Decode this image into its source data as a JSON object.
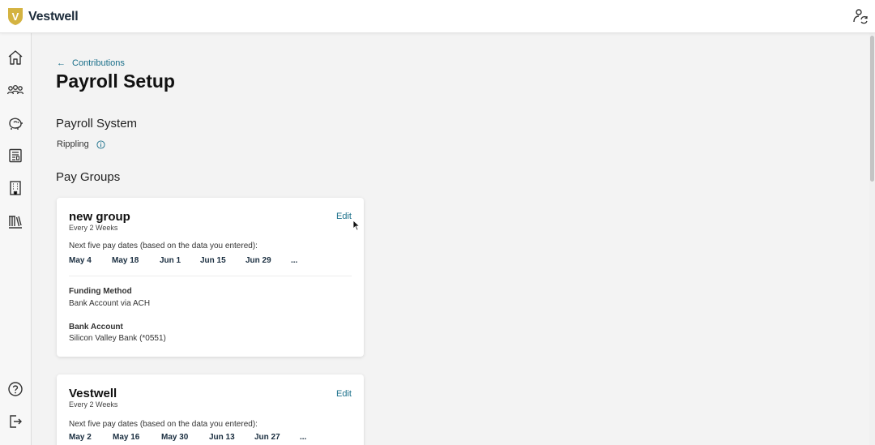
{
  "header": {
    "brand_letter": "V",
    "brand_name": "Vestwell",
    "brand_color": "#d4b341",
    "user_switch_icon": "account-switch-icon"
  },
  "sidebar": {
    "items": [
      {
        "icon": "home-icon"
      },
      {
        "icon": "people-icon"
      },
      {
        "icon": "piggy-bank-icon"
      },
      {
        "icon": "newspaper-icon"
      },
      {
        "icon": "building-icon"
      },
      {
        "icon": "library-icon"
      }
    ],
    "bottom_items": [
      {
        "icon": "help-icon"
      },
      {
        "icon": "logout-icon"
      }
    ]
  },
  "breadcrumb": {
    "label": "Contributions"
  },
  "page": {
    "title": "Payroll Setup"
  },
  "payroll_system": {
    "title": "Payroll System",
    "value": "Rippling"
  },
  "pay_groups": {
    "title": "Pay Groups",
    "groups": [
      {
        "name": "new group",
        "frequency": "Every 2 Weeks",
        "edit_label": "Edit",
        "dates_label": "Next five pay dates (based on the data you entered):",
        "dates": [
          "May 4",
          "May 18",
          "Jun 1",
          "Jun 15",
          "Jun 29",
          "..."
        ],
        "funding_method_label": "Funding Method",
        "funding_method_value": "Bank Account via ACH",
        "bank_account_label": "Bank Account",
        "bank_account_value": "Silicon Valley Bank (*0551)"
      },
      {
        "name": "Vestwell",
        "frequency": "Every 2 Weeks",
        "edit_label": "Edit",
        "dates_label": "Next five pay dates (based on the data you entered):",
        "dates": [
          "May 2",
          "May 16",
          "May 30",
          "Jun 13",
          "Jun 27",
          "..."
        ]
      }
    ]
  },
  "colors": {
    "accent_link": "#1a6f8a",
    "background": "#f3f3f3"
  }
}
